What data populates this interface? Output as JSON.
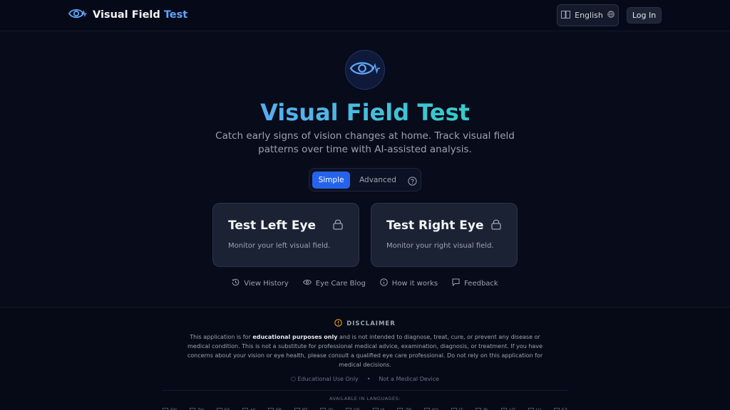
{
  "header": {
    "brand_main": "Visual Field",
    "brand_accent": "Test",
    "language": "English",
    "login": "Log In"
  },
  "hero": {
    "title": "Visual Field Test",
    "subtitle": "Catch early signs of vision changes at home. Track visual field patterns over time with AI-assisted analysis."
  },
  "mode_toggle": {
    "simple": "Simple",
    "advanced": "Advanced",
    "selected": "Simple"
  },
  "cards": [
    {
      "title": "Test Left Eye",
      "desc": "Monitor your left visual field."
    },
    {
      "title": "Test Right Eye",
      "desc": "Monitor your right visual field."
    }
  ],
  "links": {
    "history": "View History",
    "blog": "Eye Care Blog",
    "how": "How it works",
    "feedback": "Feedback"
  },
  "footer": {
    "disclaimer_title": "DISCLAIMER",
    "disc_pre": "This application is for ",
    "disc_bold": "educational purposes only",
    "disc_post": " and is not intended to diagnose, treat, cure, or prevent any disease or medical condition. This is not a substitute for professional medical advice, examination, diagnosis, or treatment. If you have concerns about your vision or eye health, please consult a qualified eye care professional. Do not rely on this application for medical decisions.",
    "badge1": "Educational Use Only",
    "badge_sep": "•",
    "badge2": "Not a Medical Device",
    "languages_title": "AVAILABLE IN LANGUAGES:",
    "languages": [
      "EN",
      "ZH",
      "ES",
      "HI",
      "FR",
      "PT",
      "ID",
      "DE",
      "JA",
      "ZB",
      "KO",
      "IT",
      "PL",
      "UT",
      "LV",
      "FZ"
    ]
  },
  "colors": {
    "accent_blue": "#2563eb",
    "brand_blue": "#60a5fa",
    "teal": "#2dd4bf",
    "warning": "#f59e0b"
  }
}
